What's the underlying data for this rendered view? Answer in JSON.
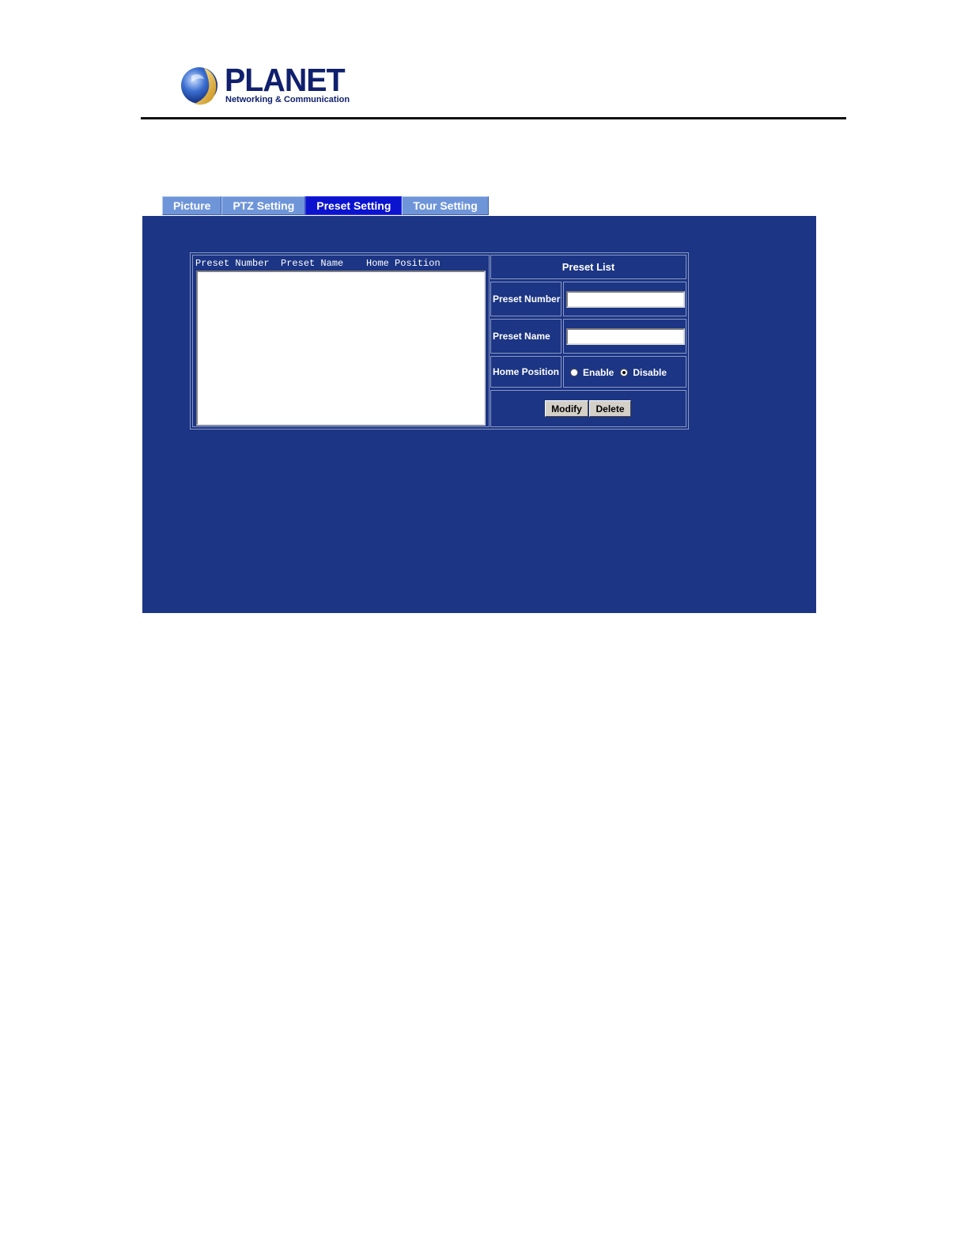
{
  "logo": {
    "name": "PLANET",
    "tagline": "Networking & Communication"
  },
  "tabs": [
    {
      "label": "Picture",
      "active": false
    },
    {
      "label": "PTZ Setting",
      "active": false
    },
    {
      "label": "Preset Setting",
      "active": true
    },
    {
      "label": "Tour Setting",
      "active": false
    }
  ],
  "preset_list": {
    "header": "Preset Number  Preset Name    Home Position",
    "rows": []
  },
  "form": {
    "title": "Preset List",
    "preset_number_label": "Preset Number",
    "preset_number_value": "",
    "preset_name_label": "Preset Name",
    "preset_name_value": "",
    "home_position_label": "Home Position",
    "home_options": [
      {
        "label": "Enable",
        "checked": false
      },
      {
        "label": "Disable",
        "checked": true
      }
    ],
    "modify_label": "Modify",
    "delete_label": "Delete"
  },
  "colors": {
    "panel_bg": "#1c3584",
    "tab_bg": "#6f95d9",
    "tab_active_bg": "#0b13cf",
    "brand": "#10206e"
  }
}
